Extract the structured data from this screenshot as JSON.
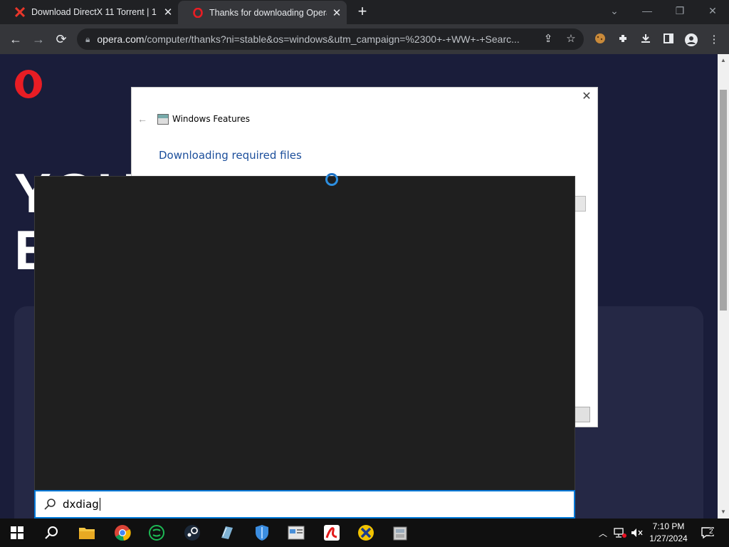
{
  "browser": {
    "tabs": [
      {
        "title": "Download DirectX 11 Torrent | 1",
        "icon": "red-x-icon"
      },
      {
        "title": "Thanks for downloading Opera",
        "icon": "opera-icon"
      }
    ],
    "url_domain": "opera.com",
    "url_path": "/computer/thanks?ni=stable&os=windows&utm_campaign=%2300+-+WW+-+Searc..."
  },
  "page": {
    "hero_line1": "YOU",
    "hero_line2": "EY"
  },
  "windows_features": {
    "title": "Windows Features",
    "heading": "Downloading required files"
  },
  "search": {
    "query": "dxdiag"
  },
  "taskbar": {
    "time": "7:10 PM",
    "date": "1/27/2024",
    "notification_count": "2"
  },
  "colors": {
    "accent": "#0078d7",
    "page_bg": "#1a1d3a",
    "opera_red": "#e81d24"
  }
}
